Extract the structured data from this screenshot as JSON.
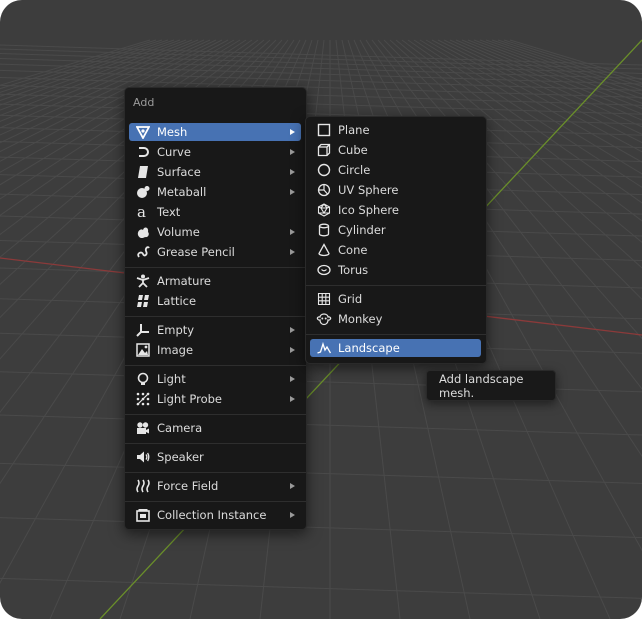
{
  "add_menu": {
    "title": "Add",
    "items": [
      {
        "label": "Mesh",
        "icon": "mesh-icon",
        "submenu": true,
        "active": true
      },
      {
        "label": "Curve",
        "icon": "curve-icon",
        "submenu": true
      },
      {
        "label": "Surface",
        "icon": "surface-icon",
        "submenu": true
      },
      {
        "label": "Metaball",
        "icon": "metaball-icon",
        "submenu": true
      },
      {
        "label": "Text",
        "icon": "text-icon",
        "submenu": false
      },
      {
        "label": "Volume",
        "icon": "volume-icon",
        "submenu": true
      },
      {
        "label": "Grease Pencil",
        "icon": "grease-pencil-icon",
        "submenu": true
      },
      {
        "label": "Armature",
        "icon": "armature-icon",
        "submenu": false
      },
      {
        "label": "Lattice",
        "icon": "lattice-icon",
        "submenu": false
      },
      {
        "label": "Empty",
        "icon": "empty-icon",
        "submenu": true
      },
      {
        "label": "Image",
        "icon": "image-icon",
        "submenu": true
      },
      {
        "label": "Light",
        "icon": "light-icon",
        "submenu": true
      },
      {
        "label": "Light Probe",
        "icon": "light-probe-icon",
        "submenu": true
      },
      {
        "label": "Camera",
        "icon": "camera-icon",
        "submenu": false
      },
      {
        "label": "Speaker",
        "icon": "speaker-icon",
        "submenu": false
      },
      {
        "label": "Force Field",
        "icon": "force-field-icon",
        "submenu": true
      },
      {
        "label": "Collection Instance",
        "icon": "collection-instance-icon",
        "submenu": true
      }
    ]
  },
  "mesh_menu": {
    "items": [
      {
        "label": "Plane",
        "icon": "plane-icon"
      },
      {
        "label": "Cube",
        "icon": "cube-icon"
      },
      {
        "label": "Circle",
        "icon": "circle-icon"
      },
      {
        "label": "UV Sphere",
        "icon": "uv-sphere-icon"
      },
      {
        "label": "Ico Sphere",
        "icon": "ico-sphere-icon"
      },
      {
        "label": "Cylinder",
        "icon": "cylinder-icon"
      },
      {
        "label": "Cone",
        "icon": "cone-icon"
      },
      {
        "label": "Torus",
        "icon": "torus-icon"
      },
      {
        "label": "Grid",
        "icon": "grid-icon"
      },
      {
        "label": "Monkey",
        "icon": "monkey-icon"
      },
      {
        "label": "Landscape",
        "icon": "landscape-icon",
        "active": true
      }
    ]
  },
  "tooltip": {
    "text": "Add landscape mesh."
  },
  "colors": {
    "viewport_bg": "#3d3d3d",
    "menu_bg": "#181818",
    "highlight": "#4772b3",
    "x_axis": "#8b3a3a",
    "y_axis": "#6a8f2a"
  }
}
